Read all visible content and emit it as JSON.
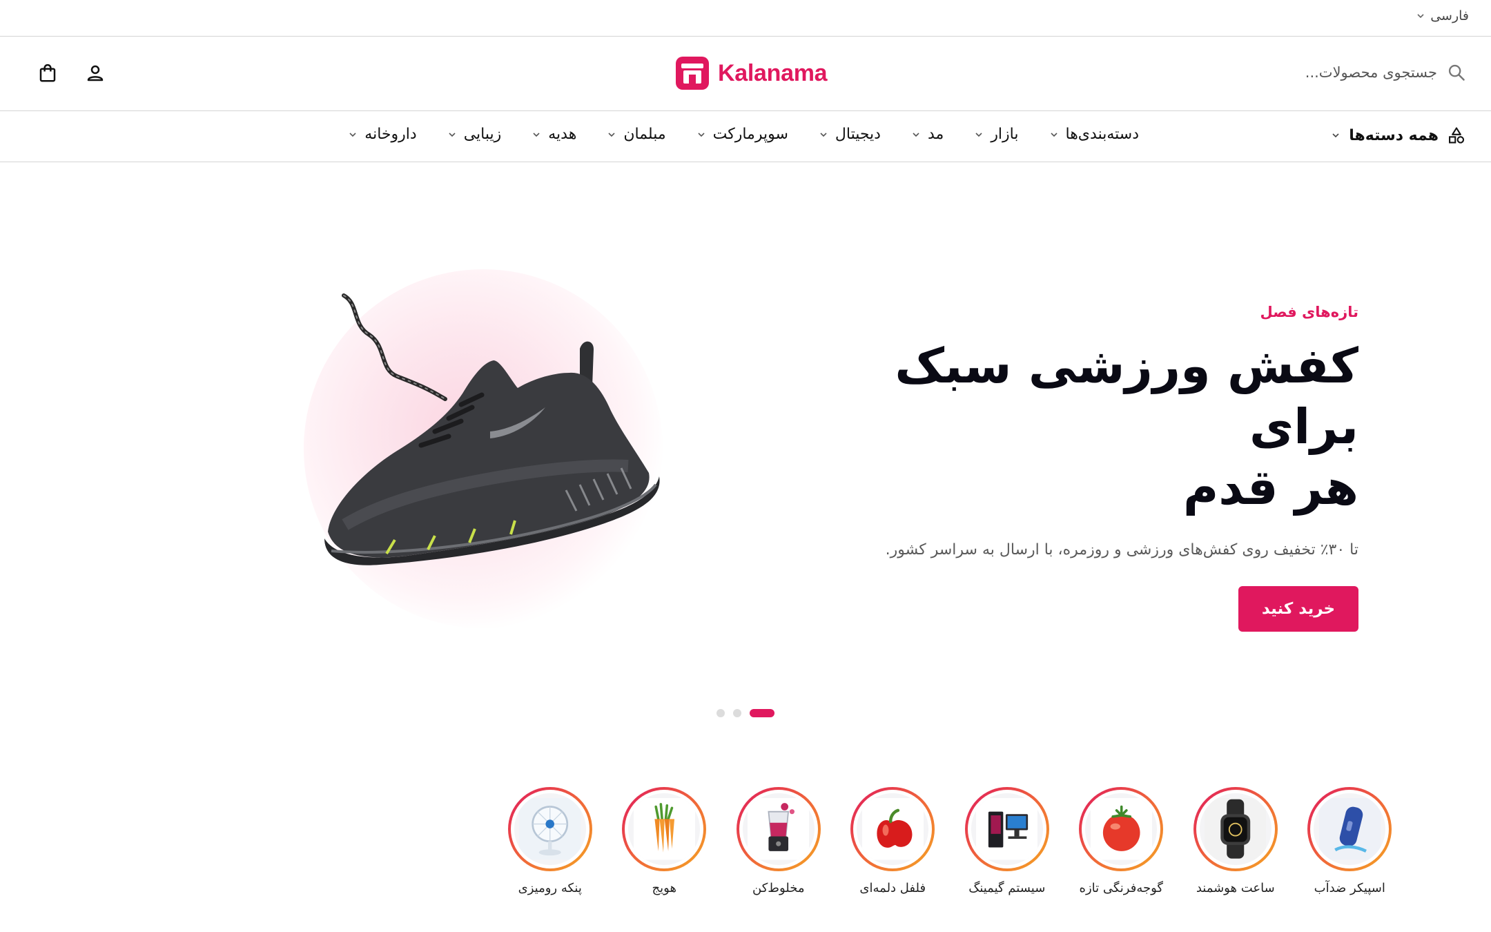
{
  "topbar": {
    "language": "فارسی"
  },
  "header": {
    "search_placeholder": "جستجوی محصولات...",
    "logo_text": "Kalanama",
    "icons": {
      "search": "search-icon",
      "cart": "shopping-bag-icon",
      "user": "user-icon"
    }
  },
  "nav": {
    "all_categories": "همه دسته‌ها",
    "items": [
      {
        "label": "دسته‌بندی‌ها"
      },
      {
        "label": "بازار"
      },
      {
        "label": "مد"
      },
      {
        "label": "دیجیتال"
      },
      {
        "label": "سوپرمارکت"
      },
      {
        "label": "مبلمان"
      },
      {
        "label": "هدیه"
      },
      {
        "label": "زیبایی"
      },
      {
        "label": "داروخانه"
      }
    ]
  },
  "hero": {
    "eyebrow": "تازه‌های فصل",
    "title_line1": "کفش ورزشی سبک برای",
    "title_line2": "هر قدم",
    "subtitle": "تا ۳۰٪ تخفیف روی کفش‌های ورزشی و روزمره، با ارسال به سراسر کشور.",
    "cta": "خرید کنید",
    "slides_total": 3,
    "active_slide": 1
  },
  "stories": [
    {
      "label": "اسپیکر ضدآب",
      "icon": "speaker-icon"
    },
    {
      "label": "ساعت هوشمند",
      "icon": "smartwatch-icon"
    },
    {
      "label": "گوجه‌فرنگی تازه",
      "icon": "tomato-icon"
    },
    {
      "label": "سیستم گیمینگ",
      "icon": "gaming-pc-icon"
    },
    {
      "label": "فلفل دلمه‌ای",
      "icon": "bell-pepper-icon"
    },
    {
      "label": "مخلوط‌کن",
      "icon": "blender-icon"
    },
    {
      "label": "هویج",
      "icon": "carrot-icon"
    },
    {
      "label": "پنکه رومیزی",
      "icon": "desk-fan-icon"
    }
  ],
  "colors": {
    "accent": "#e0185e",
    "text": "#0a0a14",
    "muted": "#5a5a5a",
    "border": "#d4d4d4"
  }
}
